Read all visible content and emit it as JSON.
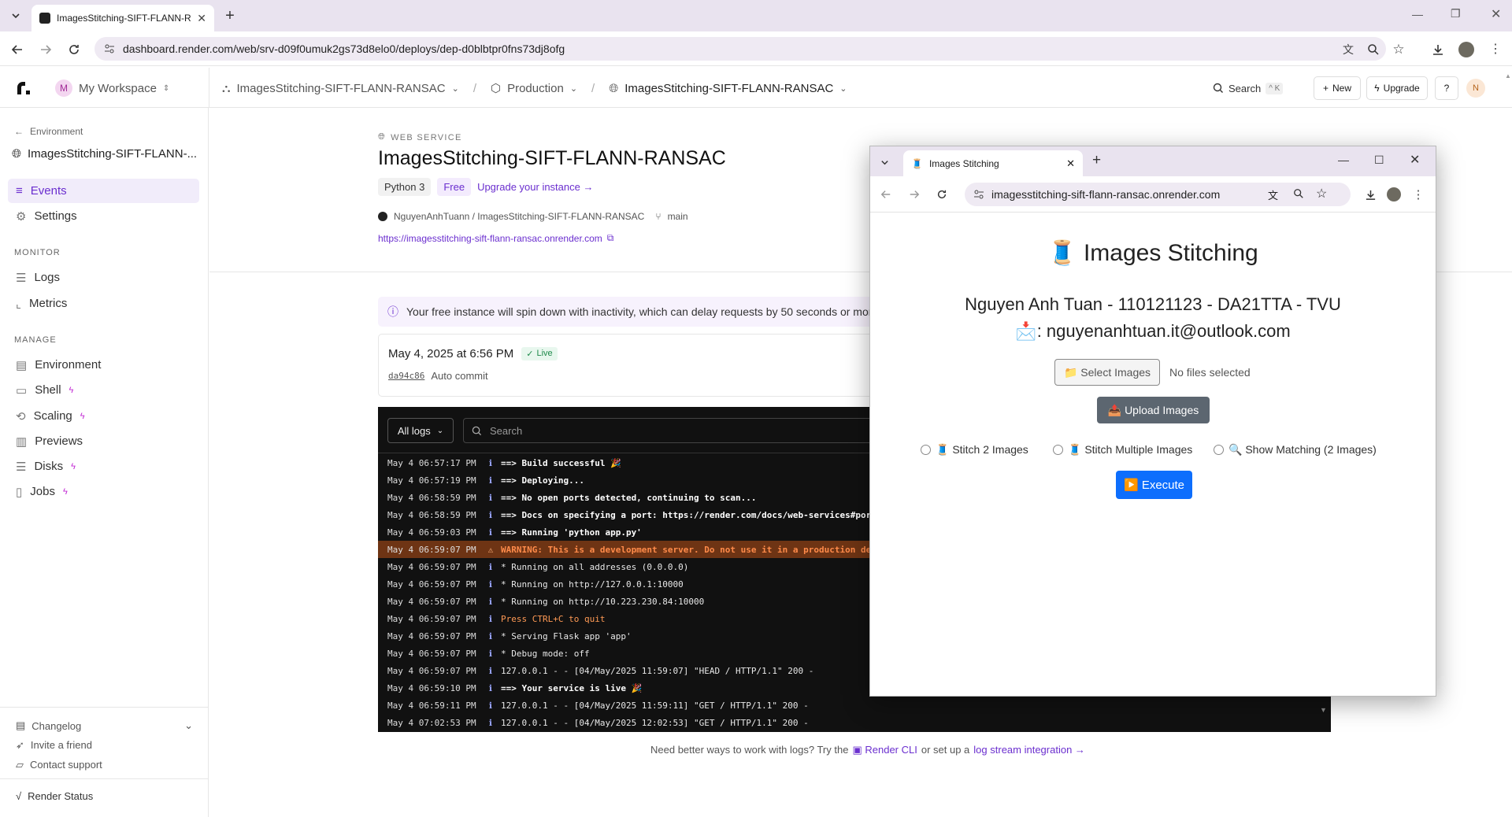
{
  "browser": {
    "tab_title": "ImagesStitching-SIFT-FLANN-R",
    "url": "dashboard.render.com/web/srv-d09f0umuk2gs73d8elo0/deploys/dep-d0blbtpr0fns73dj8ofg"
  },
  "header": {
    "workspace_initial": "M",
    "workspace": "My Workspace",
    "crumb_project": "ImagesStitching-SIFT-FLANN-RANSAC",
    "crumb_env": "Production",
    "crumb_service": "ImagesStitching-SIFT-FLANN-RANSAC",
    "search_label": "Search",
    "search_shortcut": "^ K",
    "new_label": "New",
    "upgrade_label": "Upgrade",
    "avatar_initial": "N"
  },
  "sidebar": {
    "back_label": "Environment",
    "service_name": "ImagesStitching-SIFT-FLANN-...",
    "events": "Events",
    "settings": "Settings",
    "monitor_heading": "MONITOR",
    "logs": "Logs",
    "metrics": "Metrics",
    "manage_heading": "MANAGE",
    "environment": "Environment",
    "shell": "Shell",
    "scaling": "Scaling",
    "previews": "Previews",
    "disks": "Disks",
    "jobs": "Jobs",
    "changelog": "Changelog",
    "invite": "Invite a friend",
    "contact": "Contact support",
    "status": "Render Status"
  },
  "service": {
    "type_label": "WEB SERVICE",
    "title": "ImagesStitching-SIFT-FLANN-RANSAC",
    "runtime": "Python 3",
    "plan": "Free",
    "upgrade_link": "Upgrade your instance →",
    "repo": "NguyenAnhTuann / ImagesStitching-SIFT-FLANN-RANSAC",
    "branch": "main",
    "service_url": "https://imagesstitching-sift-flann-ransac.onrender.com"
  },
  "notice": "Your free instance will spin down with inactivity, which can delay requests by 50 seconds or mor",
  "deploy": {
    "date": "May 4, 2025 at 6:56 PM",
    "status": "Live",
    "commit": "da94c86",
    "commit_msg": "Auto commit"
  },
  "logs": {
    "filter": "All logs",
    "search_placeholder": "Search",
    "rows": [
      {
        "ts": "May 4 06:57:17 PM",
        "text": "==> Build successful 🎉"
      },
      {
        "ts": "May 4 06:57:19 PM",
        "text": "==> Deploying..."
      },
      {
        "ts": "May 4 06:58:59 PM",
        "text": "==> No open ports detected, continuing to scan..."
      },
      {
        "ts": "May 4 06:58:59 PM",
        "text": "==> Docs on specifying a port: https://render.com/docs/web-services#port"
      },
      {
        "ts": "May 4 06:59:03 PM",
        "text": "==> Running 'python app.py'"
      },
      {
        "ts": "May 4 06:59:07 PM",
        "text": "WARNING: This is a development server. Do not use it in a production de"
      },
      {
        "ts": "May 4 06:59:07 PM",
        "text": " * Running on all addresses (0.0.0.0)"
      },
      {
        "ts": "May 4 06:59:07 PM",
        "text": " * Running on http://127.0.0.1:10000"
      },
      {
        "ts": "May 4 06:59:07 PM",
        "text": " * Running on http://10.223.230.84:10000"
      },
      {
        "ts": "May 4 06:59:07 PM",
        "text": "Press CTRL+C to quit"
      },
      {
        "ts": "May 4 06:59:07 PM",
        "text": " * Serving Flask app 'app'"
      },
      {
        "ts": "May 4 06:59:07 PM",
        "text": " * Debug mode: off"
      },
      {
        "ts": "May 4 06:59:07 PM",
        "text": "127.0.0.1 - - [04/May/2025 11:59:07] \"HEAD / HTTP/1.1\" 200 -"
      },
      {
        "ts": "May 4 06:59:10 PM",
        "text": "==> Your service is live 🎉"
      },
      {
        "ts": "May 4 06:59:11 PM",
        "text": "127.0.0.1 - - [04/May/2025 11:59:11] \"GET / HTTP/1.1\" 200 -"
      },
      {
        "ts": "May 4 07:02:53 PM",
        "text": "127.0.0.1 - - [04/May/2025 12:02:53] \"GET / HTTP/1.1\" 200 -"
      }
    ]
  },
  "footer": {
    "prefix": "Need better ways to work with logs? Try the",
    "cli": "Render CLI",
    "middle": "or set up a",
    "stream": "log stream integration →"
  },
  "popup": {
    "tab_title": "Images Stitching",
    "url": "imagesstitching-sift-flann-ransac.onrender.com",
    "title": "🧵 Images Stitching",
    "author": "Nguyen Anh Tuan - 110121123 - DA21TTA - TVU",
    "email": "📩: nguyenanhtuan.it@outlook.com",
    "select_btn": "📁 Select Images",
    "no_files": "No files selected",
    "upload_btn": "📤 Upload Images",
    "opt1": "🧵 Stitch 2 Images",
    "opt2": "🧵 Stitch Multiple Images",
    "opt3": "🔍 Show Matching (2 Images)",
    "execute_btn": "▶️ Execute"
  }
}
